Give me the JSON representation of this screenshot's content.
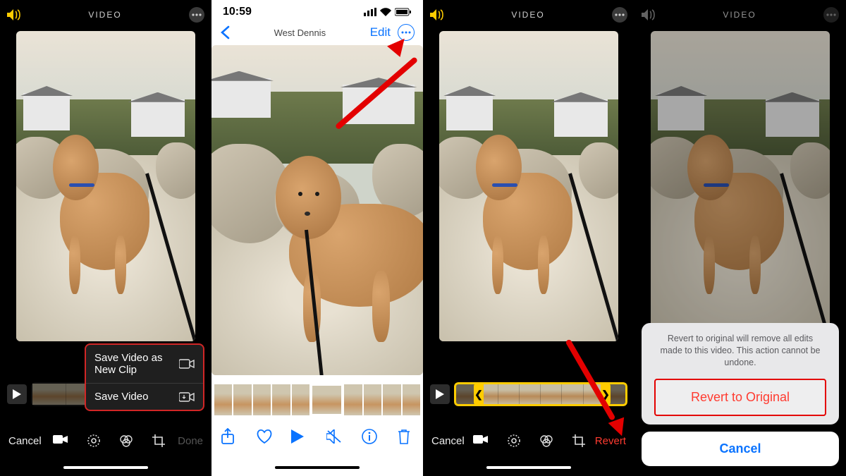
{
  "panel1": {
    "title": "VIDEO",
    "cancel": "Cancel",
    "done": "Done",
    "menu": {
      "opt1": "Save Video as New Clip",
      "opt2": "Save Video"
    }
  },
  "panel2": {
    "time": "10:59",
    "title": "West Dennis",
    "edit": "Edit"
  },
  "panel3": {
    "title": "VIDEO",
    "cancel": "Cancel",
    "revert": "Revert"
  },
  "panel4": {
    "title": "VIDEO",
    "sheet_msg": "Revert to original will remove all edits made to this video. This action cannot be undone.",
    "revert_opt": "Revert to Original",
    "cancel": "Cancel"
  }
}
